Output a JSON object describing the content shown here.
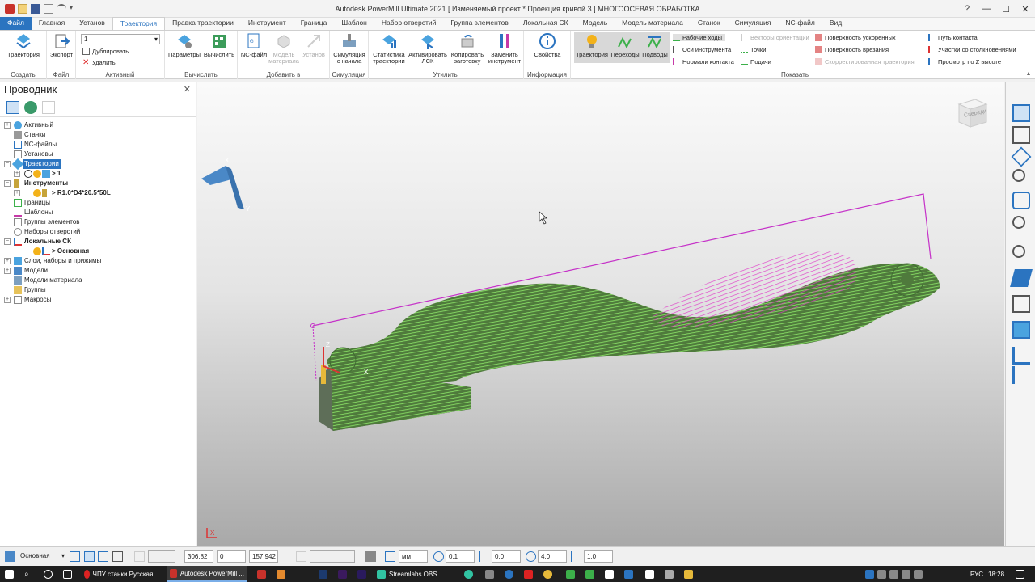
{
  "app": {
    "title": "Autodesk PowerMill Ultimate 2021    [ Изменяемый проект * Проекция кривой 3 ]    МНОГООСЕВАЯ ОБРАБОТКА"
  },
  "tabs": [
    "Файл",
    "Главная",
    "Установ",
    "Траектория",
    "Правка траектории",
    "Инструмент",
    "Граница",
    "Шаблон",
    "Набор отверстий",
    "Группа элементов",
    "Локальная СК",
    "Модель",
    "Модель материала",
    "Станок",
    "Симуляция",
    "NC-файл",
    "Вид"
  ],
  "ribbon": {
    "groups": {
      "create": "Создать",
      "file": "Файл",
      "active": "Активный",
      "calculate": "Вычислить",
      "add_to": "Добавить в",
      "simulation": "Симуляция",
      "utilities": "Утилиты",
      "info": "Информация",
      "show": "Показать"
    },
    "buttons": {
      "toolpath": "Траектория",
      "export": "Экспорт",
      "active_value": "1",
      "duplicate": "Дублировать",
      "delete": "Удалить",
      "parameters": "Параметры",
      "calculate": "Вычислить",
      "nc_file": "NC-файл",
      "stock_model": "Модель материала",
      "setup": "Установ",
      "sim_from_start": "Симуляция с начала",
      "toolpath_stats": "Статистика траектории",
      "activate_lsk": "Активировать ЛСК",
      "copy_blank": "Копировать заготовку",
      "replace_tool": "Заменить инструмент",
      "properties": "Свойства",
      "show_toolpath": "Траектория",
      "links": "Переходы",
      "leads": "Подводы"
    },
    "show_items": {
      "col1": [
        "Рабочие ходы",
        "Оси инструмента",
        "Нормали контакта"
      ],
      "col2": [
        "Векторы ориентации",
        "Точки",
        "Подачи"
      ],
      "col3": [
        "Поверхность ускоренных",
        "Поверхность врезания",
        "Скорректированная траектория"
      ],
      "col4": [
        "Путь контакта",
        "Участки со столкновениями",
        "Просмотр по Z высоте"
      ]
    }
  },
  "explorer": {
    "title": "Проводник",
    "tree": [
      {
        "label": "Активный"
      },
      {
        "label": "Станки"
      },
      {
        "label": "NC-файлы"
      },
      {
        "label": "Установы"
      },
      {
        "label": "Траектории"
      },
      {
        "label": "> 1"
      },
      {
        "label": "Инструменты"
      },
      {
        "label": "> R1.0*D4*20.5*50L"
      },
      {
        "label": "Границы"
      },
      {
        "label": "Шаблоны"
      },
      {
        "label": "Группы элементов"
      },
      {
        "label": "Наборы отверстий"
      },
      {
        "label": "Локальные СК"
      },
      {
        "label": "> Основная"
      },
      {
        "label": "Слои, наборы и прижимы"
      },
      {
        "label": "Модели"
      },
      {
        "label": "Модели материала"
      },
      {
        "label": "Группы"
      },
      {
        "label": "Макросы"
      }
    ]
  },
  "viewport": {
    "viewcube_label": "Спереди",
    "axis_x": "X",
    "axis_y": "Y",
    "axis_z": "Z",
    "colors": {
      "model": "#6fd35a",
      "toolpath": "#e03cc8",
      "workplane": "#4a88c7"
    }
  },
  "status": {
    "workplane": "Основная",
    "x": "306,82",
    "y": "0",
    "z": "157,942",
    "units": "мм",
    "tolerance": "0,1",
    "thickness": "0,0",
    "diameter": "4,0",
    "scale": "1,0"
  },
  "taskbar": {
    "items": [
      "ЧПУ станки.Русская...",
      "Autodesk PowerMill ...",
      "Streamlabs OBS"
    ],
    "lang": "РУС",
    "time": "18:28"
  }
}
